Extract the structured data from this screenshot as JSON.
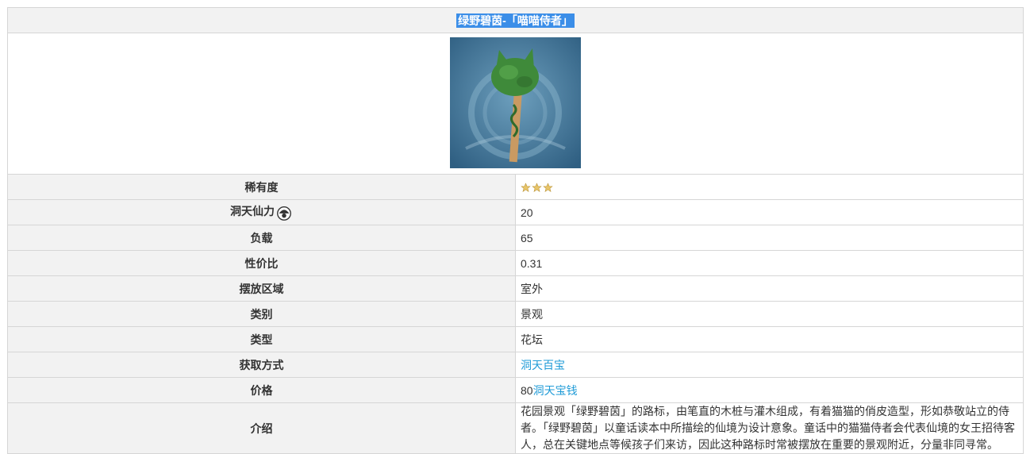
{
  "title": "绿野碧茵-「喵喵侍者」",
  "image": {
    "icon": "cat-topiary-tree-image",
    "bg": "#3a6b8f",
    "tree": "#3f8a3a"
  },
  "rows": {
    "rarity": {
      "label": "稀有度",
      "stars": 3,
      "star_color": "#e8c56a"
    },
    "adeptal": {
      "label": "洞天仙力",
      "icon": "adeptal-energy-icon",
      "value": "20"
    },
    "load": {
      "label": "负载",
      "value": "65"
    },
    "ratio": {
      "label": "性价比",
      "value": "0.31"
    },
    "placement": {
      "label": "摆放区域",
      "value": "室外"
    },
    "category": {
      "label": "类别",
      "value": "景观"
    },
    "type": {
      "label": "类型",
      "value": "花坛"
    },
    "source": {
      "label": "获取方式",
      "link": "洞天百宝"
    },
    "price": {
      "label": "价格",
      "amount": "80",
      "currency_link": "洞天宝钱"
    },
    "intro": {
      "label": "介绍",
      "text": "花园景观「绿野碧茵」的路标，由笔直的木桩与灌木组成，有着猫猫的俏皮造型，形如恭敬站立的侍者。「绿野碧茵」以童话读本中所描绘的仙境为设计意象。童话中的猫猫侍者会代表仙境的女王招待客人，总在关键地点等候孩子们来访，因此这种路标时常被摆放在重要的景观附近，分量非同寻常。"
    }
  },
  "colors": {
    "link": "#1f9bd7",
    "header_bg": "#f2f2f2",
    "title_highlight": "#3b8ee8"
  }
}
